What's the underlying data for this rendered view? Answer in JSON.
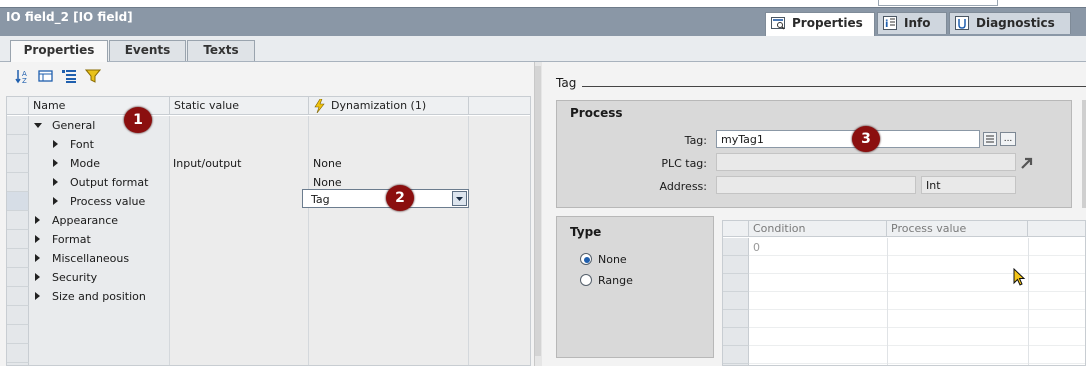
{
  "window": {
    "title": "IO field_2 [IO field]"
  },
  "inspector_tabs": [
    {
      "label": "Properties",
      "icon": "properties-icon",
      "active": true
    },
    {
      "label": "Info",
      "icon": "info-icon",
      "active": false
    },
    {
      "label": "Diagnostics",
      "icon": "diagnostics-icon",
      "active": false
    }
  ],
  "sub_tabs": [
    {
      "label": "Properties",
      "active": true
    },
    {
      "label": "Events",
      "active": false
    },
    {
      "label": "Texts",
      "active": false
    }
  ],
  "toolbar": {
    "icons": [
      "sort-icon",
      "folder-view-icon",
      "list-view-icon",
      "filter-icon"
    ]
  },
  "grid": {
    "headers": {
      "name": "Name",
      "static": "Static value",
      "dynamization": "Dynamization (1)"
    },
    "rows": [
      {
        "name": "General",
        "level": 0,
        "expanded": true,
        "static": "",
        "dyn": ""
      },
      {
        "name": "Font",
        "level": 1,
        "expanded": false,
        "static": "",
        "dyn": ""
      },
      {
        "name": "Mode",
        "level": 1,
        "expanded": false,
        "static": "Input/output",
        "dyn": "None"
      },
      {
        "name": "Output format",
        "level": 1,
        "expanded": false,
        "static": "",
        "dyn": "None"
      },
      {
        "name": "Process value",
        "level": 1,
        "expanded": false,
        "static": "",
        "dyn": "Tag"
      },
      {
        "name": "Appearance",
        "level": 0,
        "expanded": false,
        "static": "",
        "dyn": ""
      },
      {
        "name": "Format",
        "level": 0,
        "expanded": false,
        "static": "",
        "dyn": ""
      },
      {
        "name": "Miscellaneous",
        "level": 0,
        "expanded": false,
        "static": "",
        "dyn": ""
      },
      {
        "name": "Security",
        "level": 0,
        "expanded": false,
        "static": "",
        "dyn": ""
      },
      {
        "name": "Size and position",
        "level": 0,
        "expanded": false,
        "static": "",
        "dyn": ""
      }
    ]
  },
  "right": {
    "heading": "Tag",
    "process": {
      "title": "Process",
      "tag_label": "Tag:",
      "tag_value": "myTag1",
      "plc_tag_label": "PLC tag:",
      "plc_tag_value": "",
      "address_label": "Address:",
      "address_value": "",
      "address_type": "Int",
      "more_button": "..."
    },
    "type": {
      "title": "Type",
      "options": [
        {
          "label": "None",
          "selected": true
        },
        {
          "label": "Range",
          "selected": false
        }
      ]
    },
    "conditions": {
      "headers": [
        "Condition",
        "Process value"
      ],
      "first_value": "0"
    }
  },
  "markers": [
    "1",
    "2",
    "3"
  ]
}
